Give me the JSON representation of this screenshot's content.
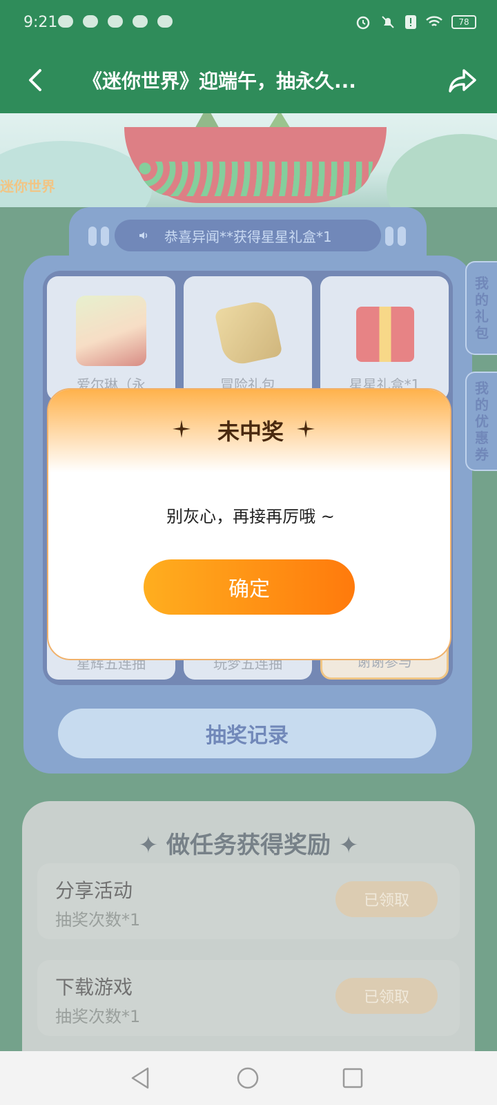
{
  "status_bar": {
    "time": "9:21",
    "battery": "78"
  },
  "header": {
    "title": "《迷你世界》迎端午，抽永久..."
  },
  "banner": {
    "logo_text": "迷你世界"
  },
  "lottery": {
    "marquee": "恭喜异闻**获得星星礼盒*1",
    "prizes_top": [
      {
        "label": "爱尔琳（永"
      },
      {
        "label": "冒险礼包"
      },
      {
        "label": "星星礼盒*1"
      }
    ],
    "prizes_bottom": [
      {
        "label": "星辉五连抽"
      },
      {
        "label": "玩梦五连抽"
      },
      {
        "label": "谢谢参与"
      }
    ],
    "record_label": "抽奖记录"
  },
  "side_tabs": [
    {
      "chars": [
        "我",
        "的",
        "礼",
        "包"
      ]
    },
    {
      "chars": [
        "我",
        "的",
        "优",
        "惠",
        "券"
      ]
    }
  ],
  "tasks": {
    "title": "做任务获得奖励",
    "items": [
      {
        "name": "分享活动",
        "count": "抽奖次数*1",
        "button": "已领取"
      },
      {
        "name": "下载游戏",
        "count": "抽奖次数*1",
        "button": "已领取"
      }
    ]
  },
  "modal": {
    "title": "未中奖",
    "message": "别灰心，再接再厉哦 ~",
    "confirm": "确定"
  },
  "colors": {
    "header": "#2f8c5a",
    "accent": "#ff8a12",
    "panel": "#3f6fb0"
  }
}
